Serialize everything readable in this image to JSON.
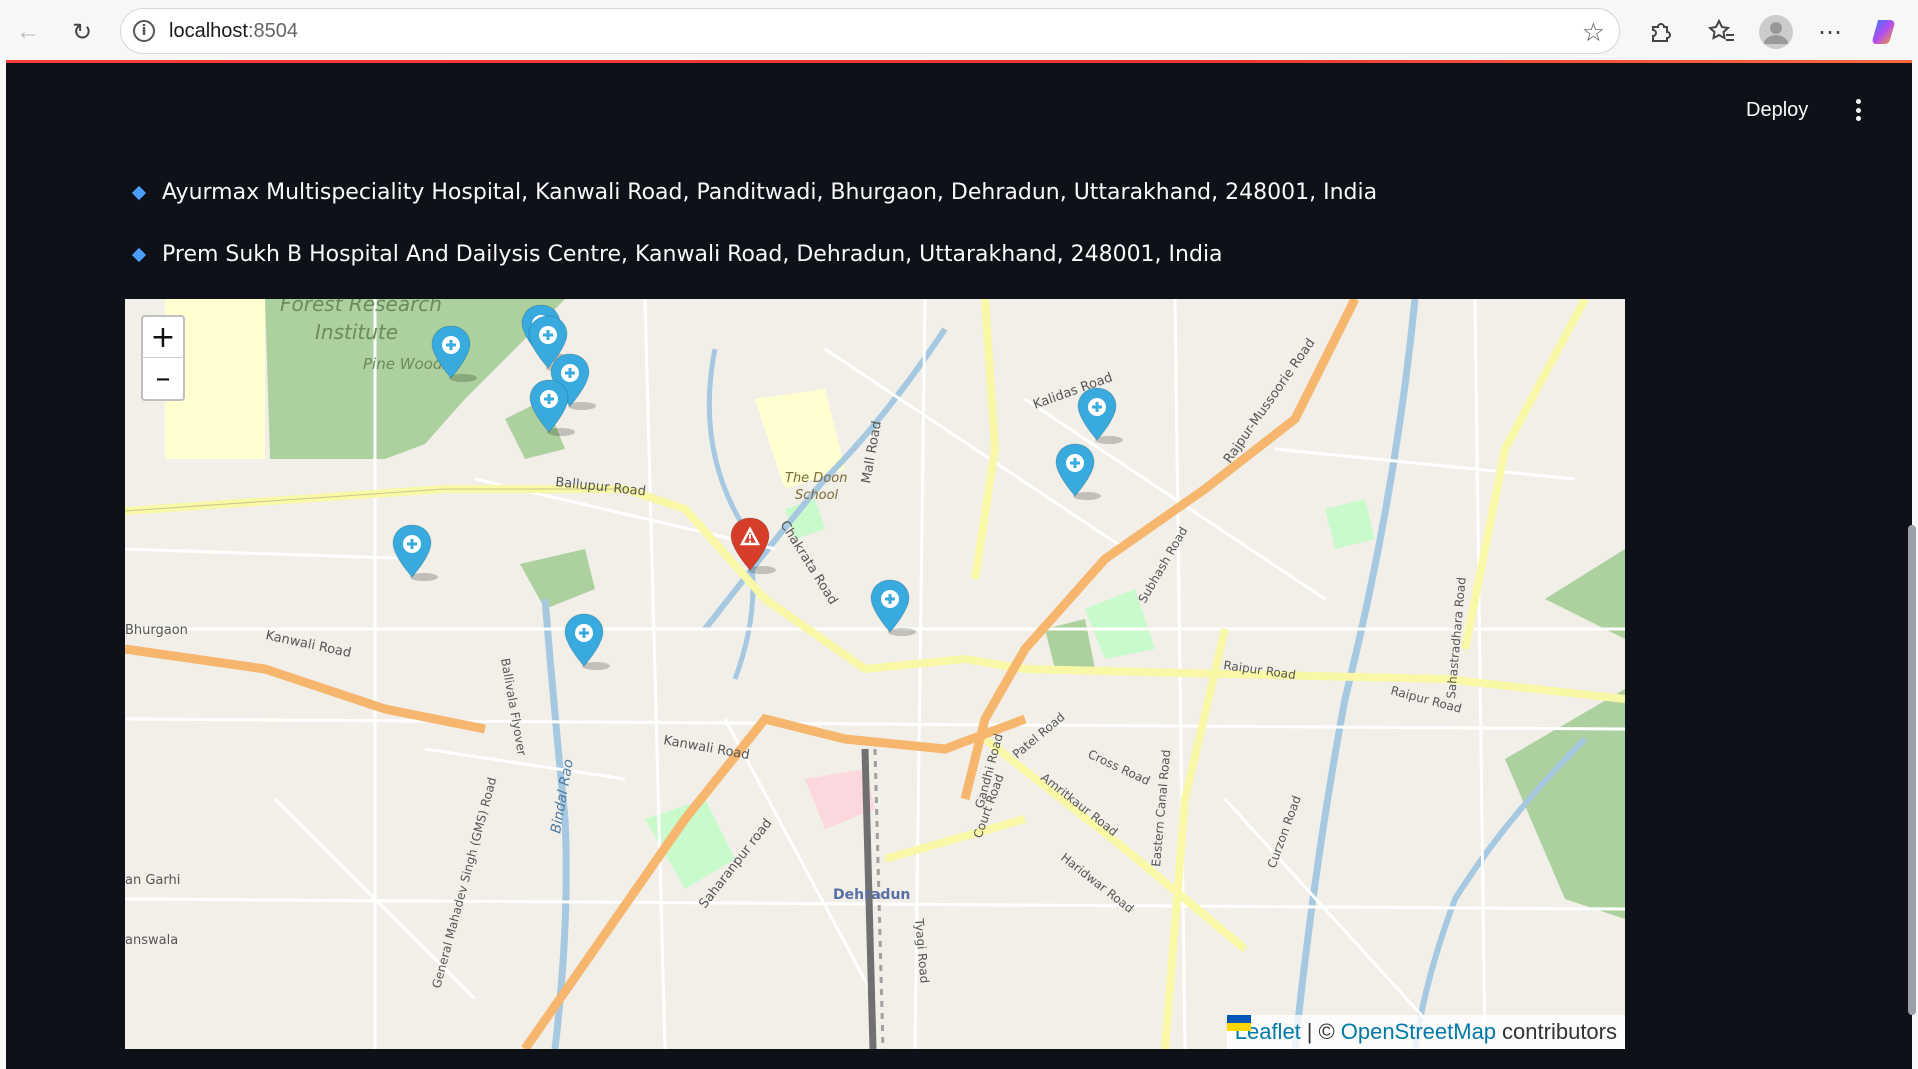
{
  "browser": {
    "url_host": "localhost",
    "url_port": ":8504"
  },
  "app": {
    "deploy_label": "Deploy",
    "hospitals": [
      "Ayurmax Multispeciality Hospital, Kanwali Road, Panditwadi, Bhurgaon, Dehradun, Uttarakhand, 248001, India",
      "Prem Sukh B Hospital And Dailysis Centre, Kanwali Road, Dehradun, Uttarakhand, 248001, India"
    ]
  },
  "map": {
    "zoom_in": "+",
    "zoom_out": "–",
    "attribution": {
      "leaflet": "Leaflet",
      "separator": "|",
      "copyright": "©",
      "osm": "OpenStreetMap",
      "contributors": "contributors"
    },
    "labels": [
      "Forest Research",
      "Institute",
      "Pine Woods",
      "Ballupur Road",
      "The Doon",
      "School",
      "Chakrata Road",
      "Mall Road",
      "Kalidas Road",
      "Rajpur-Mussoorie Road",
      "Bhurgaon",
      "Kanwali Road",
      "Ballivala Flyover",
      "Bindal Rao",
      "Kanwali Road",
      "Saharanpur road",
      "Dehradun",
      "Tyagi Road",
      "Gandhi Road",
      "Patel Road",
      "Cross Road",
      "Court Road",
      "Amritkaur Road",
      "Haridwar Road",
      "Eastern Canal Road",
      "Curzon Road",
      "Raipur Road",
      "Raipur Road",
      "Subhash Road",
      "Sahastradhara Road",
      "General Mahadev Singh (GMS) Road",
      "an Garhi",
      "answala"
    ],
    "colors": {
      "hospital_marker": "#38aadd",
      "alert_marker": "#d63e2a",
      "major_road": "#f6b66e",
      "secondary_road": "#f8f8a6",
      "river": "#a6c8e0",
      "forest": "#add19e",
      "park": "#c8facc"
    },
    "markers": [
      {
        "type": "hospital",
        "icon": "plus-circle-icon"
      },
      {
        "type": "hospital",
        "icon": "plus-circle-icon"
      },
      {
        "type": "hospital",
        "icon": "plus-circle-icon"
      },
      {
        "type": "hospital",
        "icon": "plus-circle-icon"
      },
      {
        "type": "hospital",
        "icon": "plus-circle-icon"
      },
      {
        "type": "hospital",
        "icon": "plus-circle-icon"
      },
      {
        "type": "hospital",
        "icon": "plus-circle-icon"
      },
      {
        "type": "hospital",
        "icon": "plus-circle-icon"
      },
      {
        "type": "hospital",
        "icon": "plus-circle-icon"
      },
      {
        "type": "hospital",
        "icon": "plus-circle-icon"
      },
      {
        "type": "alert",
        "icon": "warning-icon"
      }
    ]
  }
}
